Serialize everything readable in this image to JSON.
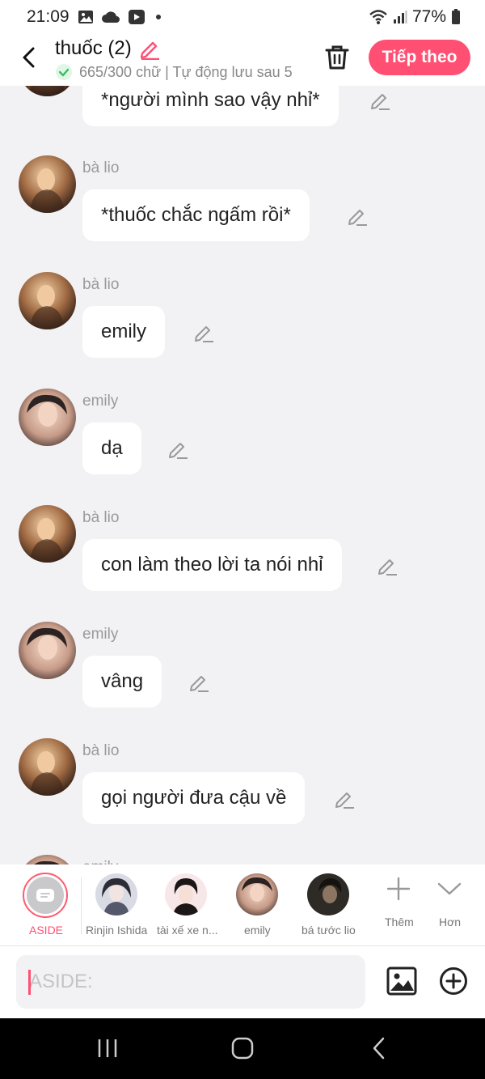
{
  "status_bar": {
    "time": "21:09",
    "battery": "77%"
  },
  "header": {
    "title": "thuốc (2)",
    "subtitle": "665/300 chữ | Tự động lưu sau 5",
    "next_label": "Tiếp theo"
  },
  "messages": [
    {
      "name": "",
      "text": "*người mình sao vậy nhỉ*"
    },
    {
      "name": "bà lio",
      "text": "*thuốc chắc ngấm rồi*"
    },
    {
      "name": "bà lio",
      "text": "emily"
    },
    {
      "name": "emily",
      "text": "dạ"
    },
    {
      "name": "bà lio",
      "text": "con làm theo lời ta nói nhỉ"
    },
    {
      "name": "emily",
      "text": "vâng"
    },
    {
      "name": "bà lio",
      "text": "gọi người đưa cậu về"
    },
    {
      "name": "emily",
      "text": ""
    }
  ],
  "characters": {
    "aside_label": "ASIDE",
    "items": [
      {
        "label": "Rinjin Ishida"
      },
      {
        "label": "tài xế xe n..."
      },
      {
        "label": "emily"
      },
      {
        "label": "bá tước lio"
      }
    ],
    "more_label": "Thêm",
    "expand_label": "Hơn"
  },
  "composer": {
    "placeholder": "ASIDE:"
  },
  "colors": {
    "accent": "#ff4f72",
    "background": "#f2f2f4"
  }
}
